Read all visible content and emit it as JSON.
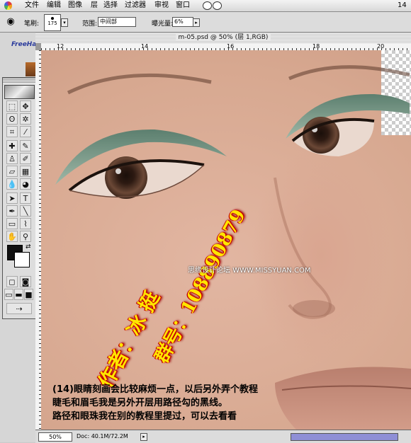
{
  "menubar": {
    "items": [
      "文件",
      "编辑",
      "图像",
      "层",
      "选择",
      "过滤器",
      "审视",
      "窗口"
    ],
    "clock": "14"
  },
  "options": {
    "brush_label": "笔刷:",
    "brush_size": "175",
    "range_label": "范围:",
    "range_value": "中间部",
    "exposure_label": "曝光量:",
    "exposure_value": "6%"
  },
  "left_panel": {
    "freehand_text": "FreeHa"
  },
  "document": {
    "title": "m-05.psd @ 50% (层 1,RGB)",
    "ruler_ticks": [
      "12",
      "14",
      "16",
      "18",
      "20"
    ],
    "zoom": "50%",
    "doc_info": "Doc: 40.1M/72.2M"
  },
  "watermark": {
    "author": "作者：冰 挺",
    "group": "群号：108890879",
    "site": "思缘设计论坛 WWW.MISSYUAN.COM"
  },
  "caption": {
    "line1": "(14)眼睛刻画会比较麻烦一点，以后另外弄个教程",
    "line2": "睫毛和眉毛我是另外开层用路径勾的黑线。",
    "line3": "路径和眼珠我在别的教程里提过，可以去看看"
  },
  "colors": {
    "foreground": "#111111",
    "background": "#ffffff",
    "scrollbar": "#8f8fd6"
  }
}
